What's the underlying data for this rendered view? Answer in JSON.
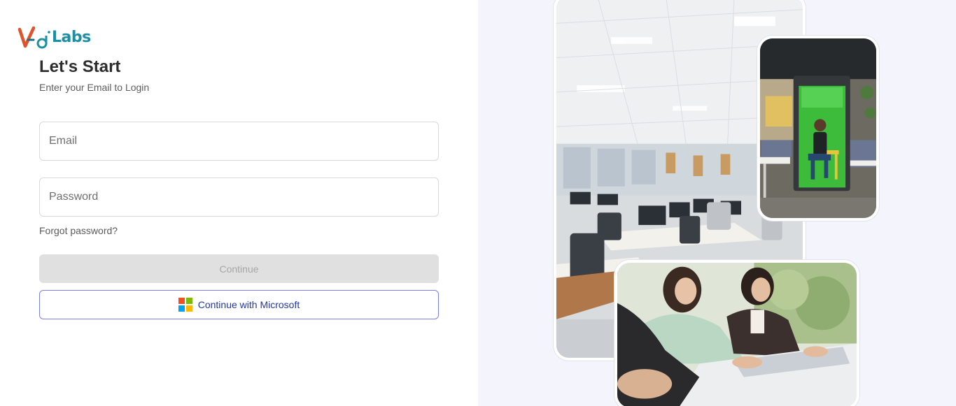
{
  "brand": {
    "logo_text": "Labs",
    "logo_mark": "V-Ai",
    "accent": "#1b8fa3",
    "mark_color": "#e0522d"
  },
  "login": {
    "title": "Let's Start",
    "subtitle": "Enter your Email to Login",
    "email_placeholder": "Email",
    "email_value": "",
    "password_placeholder": "Password",
    "password_value": "",
    "forgot_label": "Forgot password?",
    "continue_label": "Continue",
    "microsoft_label": "Continue with Microsoft"
  },
  "colors": {
    "right_panel_bg": "#f4f4fd",
    "continue_disabled_bg": "#e0e0e0",
    "microsoft_border": "#7a7ee8",
    "microsoft_text": "#2438a6"
  },
  "icons": {
    "microsoft": "microsoft-logo-icon"
  },
  "images": [
    {
      "name": "office-photo",
      "alt": ""
    },
    {
      "name": "phone-booth-photo",
      "alt": ""
    },
    {
      "name": "call-center-photo",
      "alt": ""
    }
  ]
}
